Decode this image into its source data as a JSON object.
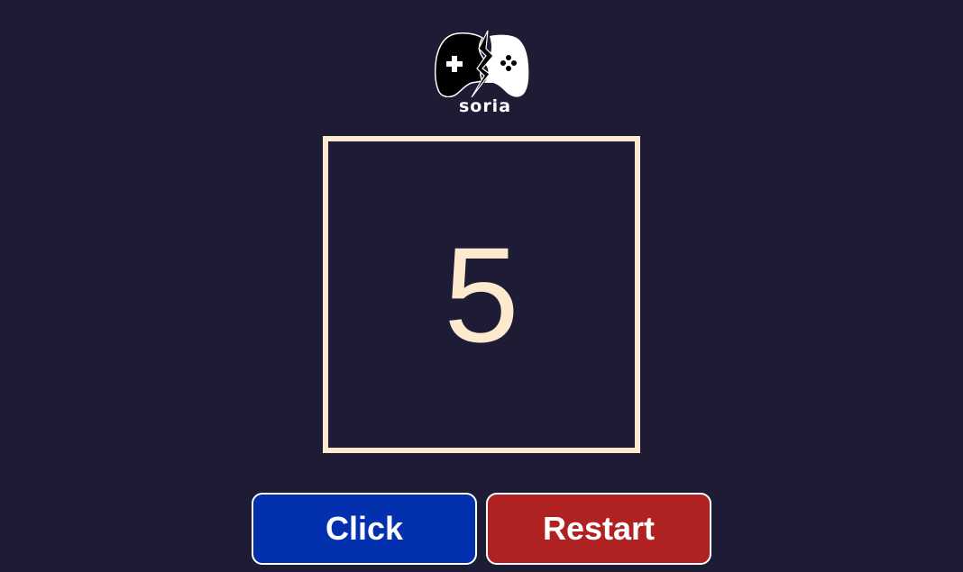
{
  "logo": {
    "text": "soria",
    "icon": "gamepad-logo-icon"
  },
  "counter": {
    "value": "5"
  },
  "buttons": {
    "click_label": "Click",
    "restart_label": "Restart"
  },
  "colors": {
    "background": "#1e1c34",
    "accent": "#fde9cd",
    "click_button": "#0230ae",
    "restart_button": "#b02222"
  }
}
